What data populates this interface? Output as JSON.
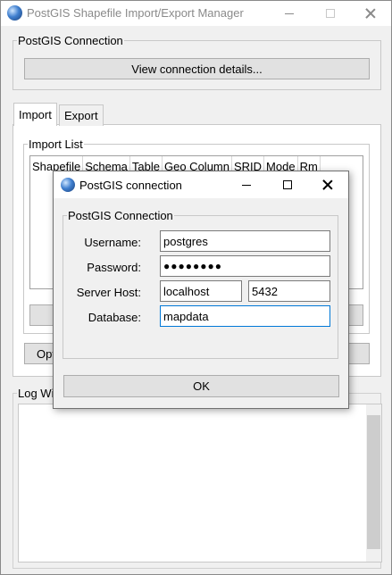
{
  "main": {
    "title": "PostGIS Shapefile Import/Export Manager",
    "connection_group": "PostGIS Connection",
    "view_details_button": "View connection details...",
    "tabs": [
      {
        "label": "Import",
        "active": true
      },
      {
        "label": "Export",
        "active": false
      }
    ],
    "import_list_group": "Import List",
    "columns": [
      "Shapefile",
      "Schema",
      "Table",
      "Geo Column",
      "SRID",
      "Mode",
      "Rm"
    ],
    "options_button_partial": "Opt",
    "log_group_partial": "Log Wi"
  },
  "dialog": {
    "title": "PostGIS connection",
    "group": "PostGIS Connection",
    "username": {
      "label": "Username:",
      "value": "postgres"
    },
    "password": {
      "label": "Password:",
      "value": "●●●●●●●●"
    },
    "server": {
      "label": "Server Host:",
      "host": "localhost",
      "port": "5432"
    },
    "database": {
      "label": "Database:",
      "value": "mapdata"
    },
    "ok_button": "OK"
  },
  "colors": {
    "accent": "#0078d7",
    "window_bg": "#f0f0f0",
    "button_bg": "#e1e1e1"
  }
}
